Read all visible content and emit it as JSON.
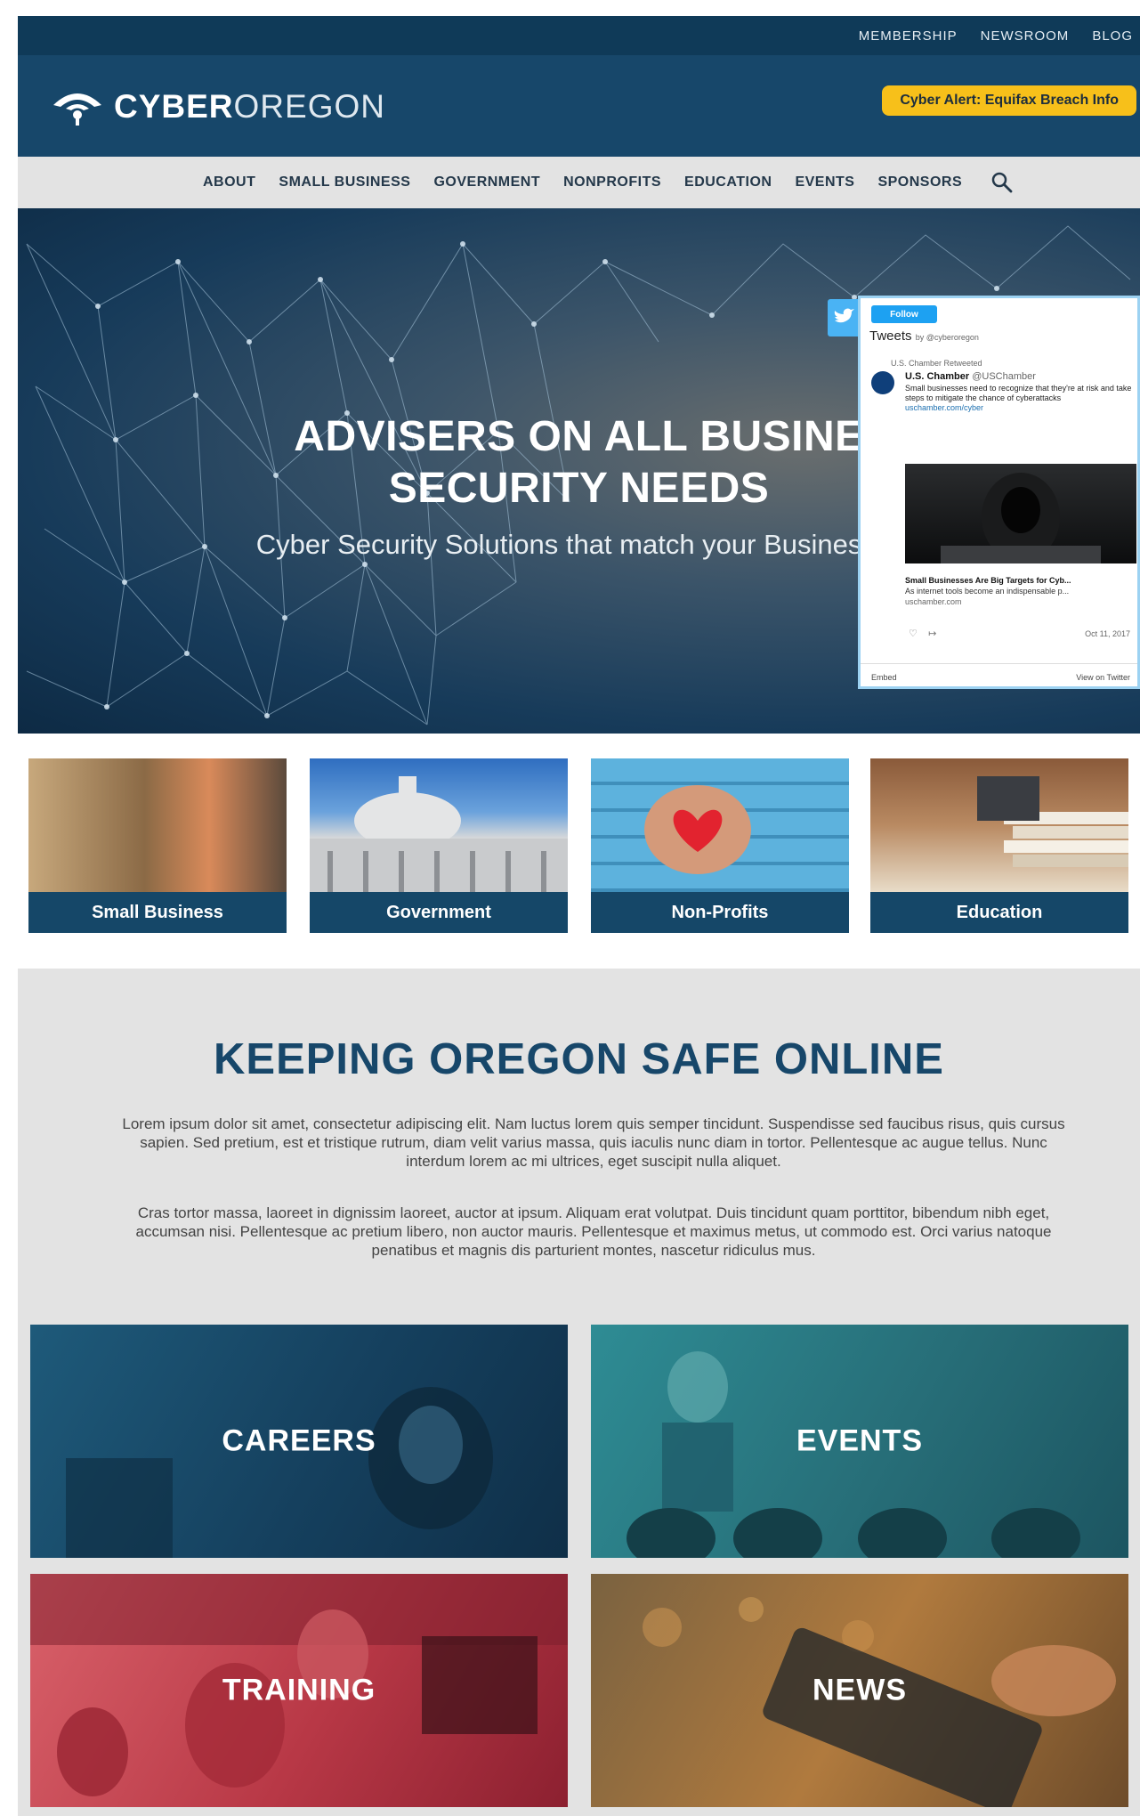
{
  "top_bar": {
    "links": [
      "MEMBERSHIP",
      "NEWSROOM",
      "BLOG"
    ]
  },
  "header": {
    "logo_bold": "CYBER",
    "logo_light": "OREGON",
    "alert_label": "Cyber Alert: Equifax Breach Info"
  },
  "nav": {
    "items": [
      "ABOUT",
      "SMALL BUSINESS",
      "GOVERNMENT",
      "NONPROFITS",
      "EDUCATION",
      "EVENTS",
      "SPONSORS"
    ],
    "search_icon": "search-icon"
  },
  "hero": {
    "title_line1": "ADVISERS ON ALL BUSINE",
    "title_line2": "SECURITY NEEDS",
    "subtitle": "Cyber Security Solutions that match your Business E"
  },
  "twitter": {
    "follow": "Follow",
    "heading": "Tweets",
    "heading_by": "by @cyberoregon",
    "retweeted": "U.S. Chamber Retweeted",
    "name": "U.S. Chamber",
    "handle": "@USChamber",
    "text": "Small businesses need to recognize that they're at risk and take steps to mitigate the chance of cyberattacks",
    "link": "uschamber.com/cyber",
    "card_title": "Small Businesses Are Big Targets for Cyb...",
    "card_desc": "As internet tools become an indispensable p...",
    "card_url": "uschamber.com",
    "date": "Oct 11, 2017",
    "embed": "Embed",
    "view": "View on Twitter"
  },
  "cards": [
    {
      "label": "Small Business"
    },
    {
      "label": "Government"
    },
    {
      "label": "Non-Profits"
    },
    {
      "label": "Education"
    }
  ],
  "keeping": {
    "title": "KEEPING OREGON SAFE ONLINE",
    "p1": "Lorem ipsum dolor sit amet, consectetur adipiscing elit. Nam luctus lorem quis semper tincidunt. Suspendisse sed faucibus risus, quis cursus sapien. Sed pretium, est et tristique rutrum, diam velit varius massa, quis iaculis nunc diam in tortor. Pellentesque ac augue tellus. Nunc interdum lorem ac mi ultrices, eget suscipit nulla aliquet.",
    "p2": "Cras tortor massa, laoreet in dignissim laoreet, auctor at ipsum. Aliquam erat volutpat. Duis tincidunt quam porttitor, bibendum nibh eget, accumsan nisi. Pellentesque ac pretium libero, non auctor mauris. Pellentesque et maximus metus, ut commodo est. Orci varius natoque penatibus et magnis dis parturient montes, nascetur ridiculus mus."
  },
  "tiles": {
    "careers": "CAREERS",
    "events": "EVENTS",
    "training": "TRAINING",
    "news": "NEWS"
  },
  "colors": {
    "brand_dark": "#0f3a58",
    "brand": "#17476a",
    "alert_yellow": "#f7c01a",
    "nav_bg": "#e3e3e3",
    "twitter_blue": "#1da1f2"
  }
}
